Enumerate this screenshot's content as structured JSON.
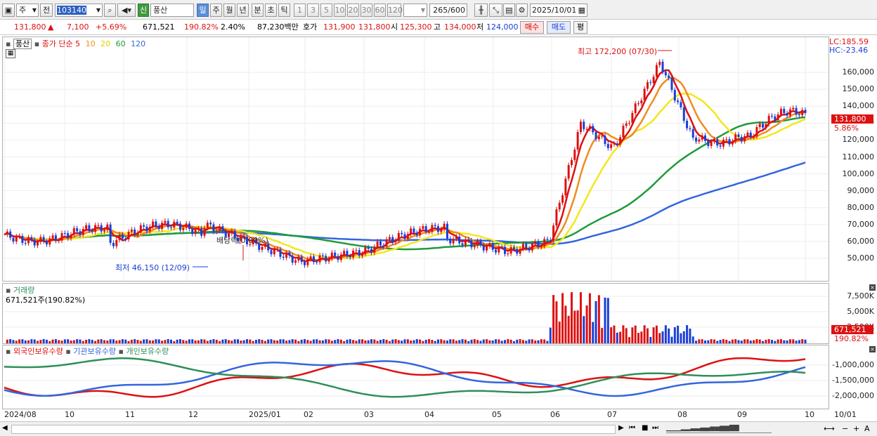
{
  "toolbar": {
    "type_label": "주",
    "scope_label": "전",
    "code": "103140",
    "name": "풍산",
    "new_badge": "신",
    "periods": [
      "일",
      "주",
      "월",
      "년",
      "분",
      "초",
      "틱"
    ],
    "active_period": "일",
    "intervals": [
      "1",
      "3",
      "5",
      "10",
      "20",
      "30",
      "60",
      "120"
    ],
    "count": "265",
    "count_total": "/600",
    "date": "2025/10/01"
  },
  "quote": {
    "price": "131,800",
    "arrow": "▲",
    "change": "7,100",
    "change_pct": "+5.69%",
    "volume": "671,521",
    "volume_ratio": "190.82%",
    "turnover": "2.40%",
    "amount": "87,230백만",
    "hoga_label": "호가",
    "ask": "131,900",
    "bid": "131,800",
    "open_label": "시",
    "open": "125,300",
    "high_label": "고",
    "high": "134,000",
    "low_label": "저",
    "low": "124,000",
    "buy_label": "매수",
    "sell_label": "매도",
    "eval_label": "평"
  },
  "price_panel": {
    "stock_tag": "풍산",
    "ma_title": "종가 단순",
    "ma_periods": [
      "5",
      "10",
      "20",
      "60",
      "120"
    ],
    "lc": "LC:185.59",
    "hc": "HC:-23.46",
    "high_note": "최고 172,200 (07/30)",
    "low_note": "최저 46,150 (12/09)",
    "dividend_note": "배당락(0.00%)",
    "current_tag": "131,800",
    "current_pct": "5.86%",
    "y_ticks": [
      "160,000",
      "150,000",
      "140,000",
      "130,000",
      "120,000",
      "110,000",
      "100,000",
      "90,000",
      "80,000",
      "70,000",
      "60,000",
      "50,000"
    ]
  },
  "volume_panel": {
    "title": "거래량",
    "value": "671,521주(190.82%)",
    "y_ticks": [
      "7,500K",
      "5,000K",
      "2,500K"
    ],
    "current_tag": "671,521",
    "current_pct": "190.82%"
  },
  "holder_panel": {
    "series": [
      "외국인보유수량",
      "기관보유수량",
      "개인보유수량"
    ],
    "y_ticks": [
      "-1,000,000",
      "-1,500,000",
      "-2,000,000"
    ]
  },
  "x_axis": {
    "labels": [
      "2024/08",
      "10",
      "11",
      "12",
      "2025/01",
      "02",
      "03",
      "04",
      "05",
      "06",
      "07",
      "08",
      "09",
      "10",
      "10/01"
    ]
  },
  "colors": {
    "up": "#dd1111",
    "down": "#1a3fd8",
    "ma5": "#dd1111",
    "ma10": "#f08c1e",
    "ma20": "#f5e61e",
    "ma60": "#1f9a3a",
    "ma120": "#3366dd",
    "foreign": "#dd1111",
    "institution": "#3366dd",
    "individual": "#2f8f5a"
  }
}
